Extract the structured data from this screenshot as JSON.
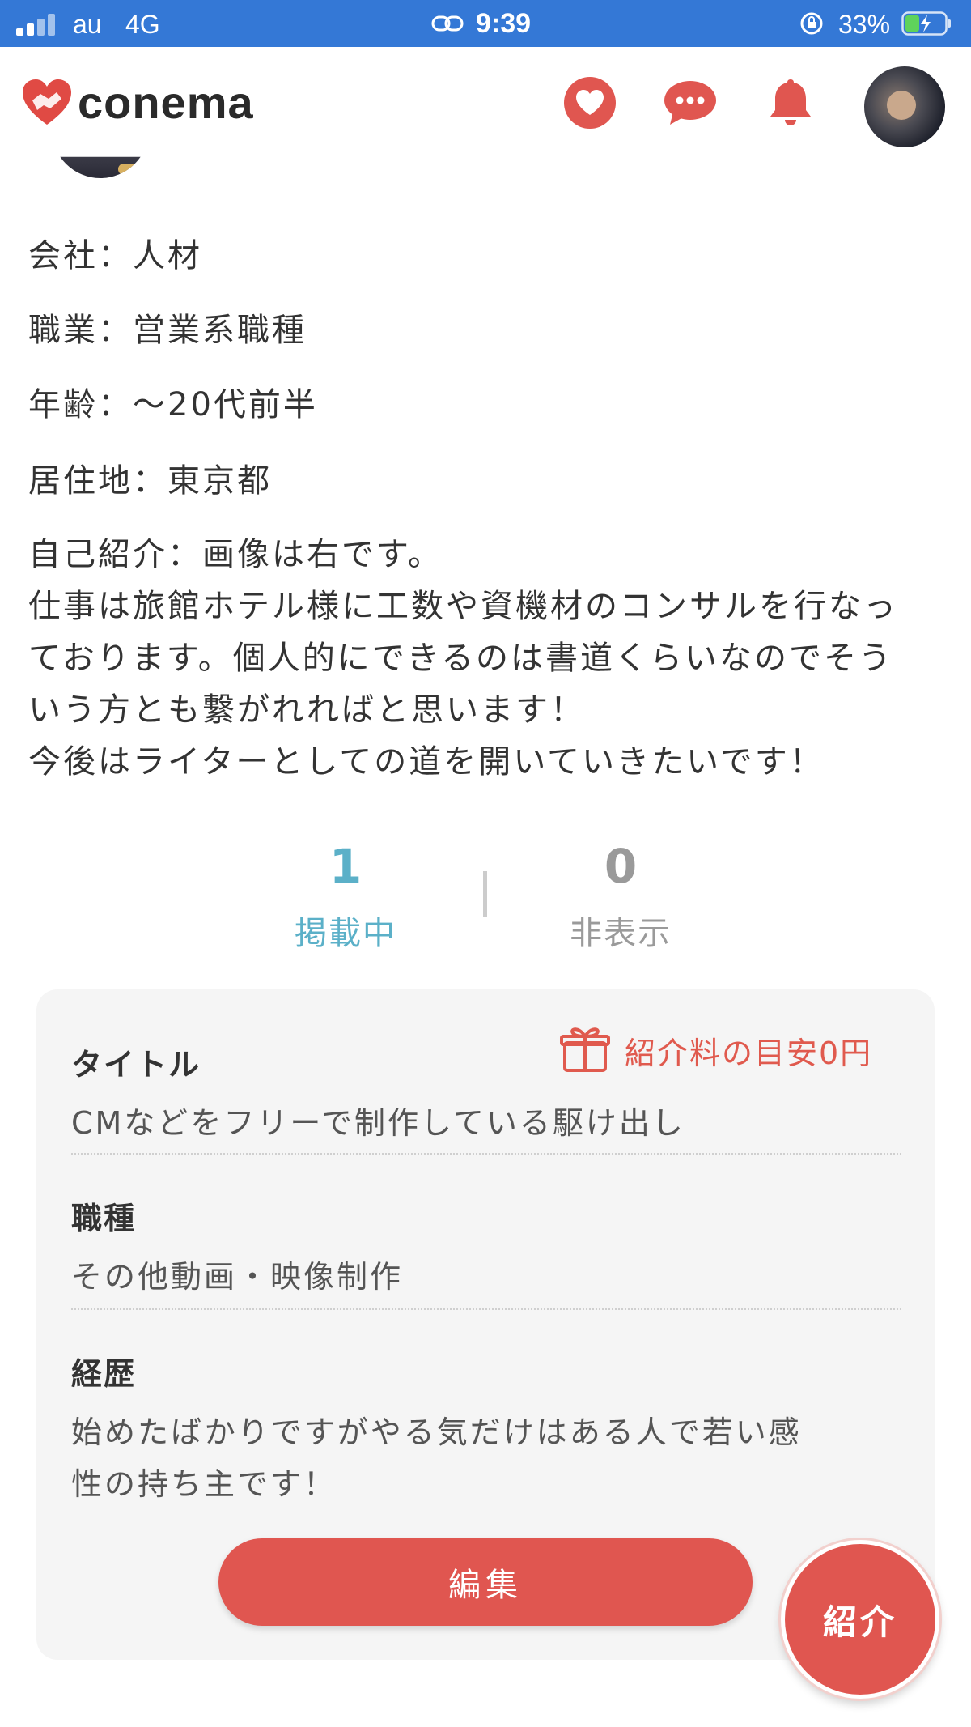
{
  "status_bar": {
    "carrier": "au",
    "network": "4G",
    "time": "9:39",
    "battery": "33%"
  },
  "header": {
    "logo_text": "conema",
    "icons": [
      "heart-icon",
      "chat-icon",
      "bell-icon"
    ],
    "accent_color": "#e05650"
  },
  "profile": {
    "company": "会社：人材",
    "occupation": "職業：営業系職種",
    "age": "年齢：～20代前半",
    "residence": "居住地：東京都",
    "intro_lines": [
      "自己紹介：画像は右です。",
      "仕事は旅館ホテル様に工数や資機材のコンサルを行なっ",
      "ております。個人的にできるのは書道くらいなのでそう",
      "いう方とも繋がれればと思います！",
      "今後はライターとしての道を開いていきたいです！"
    ]
  },
  "counters": {
    "published_count": "1",
    "published_label": "掲載中",
    "hidden_count": "0",
    "hidden_label": "非表示",
    "published_color": "#5bb0c8",
    "hidden_color": "#9a9a9a"
  },
  "card": {
    "fee_label": "紹介料の目安0円",
    "title_label": "タイトル",
    "title_value": "CMなどをフリーで制作している駆け出し",
    "job_label": "職種",
    "job_value": "その他動画・映像制作",
    "career_label": "経歴",
    "career_lines": [
      "始めたばかりですがやる気だけはある人で若い感",
      "性の持ち主です！"
    ]
  },
  "buttons": {
    "edit": "編集",
    "introduce": "紹介"
  }
}
